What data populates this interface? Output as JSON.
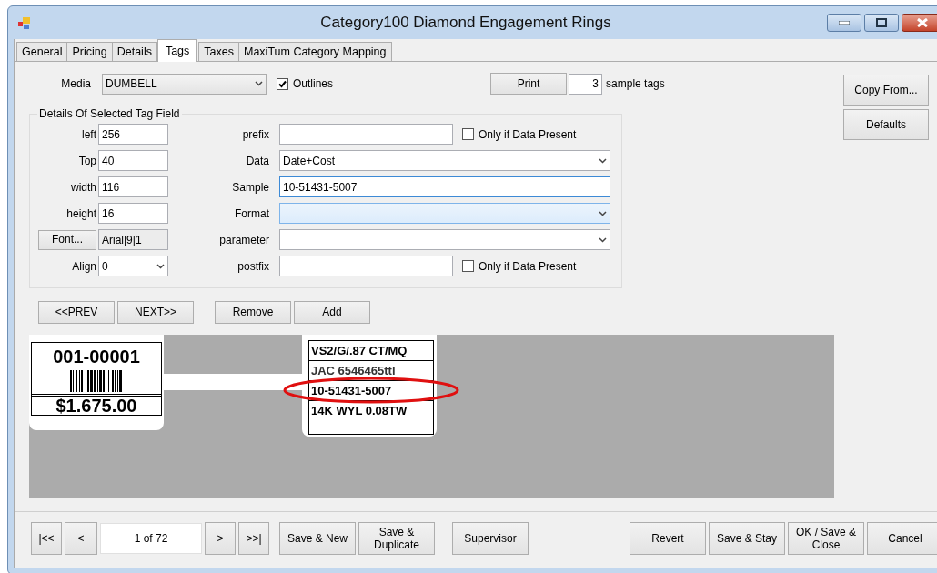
{
  "window": {
    "title": "Category100 Diamond Engagement Rings"
  },
  "tabs": [
    {
      "label": "General",
      "selected": false
    },
    {
      "label": "Pricing",
      "selected": false
    },
    {
      "label": "Details",
      "selected": false
    },
    {
      "label": "Tags",
      "selected": true
    },
    {
      "label": "Taxes",
      "selected": false
    },
    {
      "label": "MaxiTum Category Mapping",
      "selected": false
    }
  ],
  "media": {
    "label": "Media",
    "value": "DUMBELL"
  },
  "outlines": {
    "label": "Outlines",
    "checked": true
  },
  "print_button": "Print",
  "sample_count": "3",
  "sample_tags_label": "sample tags",
  "group_title": "Details Of Selected Tag Field",
  "position_fields": [
    {
      "label": "left",
      "value": "256",
      "kind": "text"
    },
    {
      "label": "Top",
      "value": "40",
      "kind": "text"
    },
    {
      "label": "width",
      "value": "116",
      "kind": "text"
    },
    {
      "label": "height",
      "value": "16",
      "kind": "text"
    },
    {
      "label": "Font...",
      "value": "Arial|9|1",
      "kind": "font"
    },
    {
      "label": "Align",
      "value": "0",
      "kind": "select"
    }
  ],
  "data_fields": [
    {
      "label": "prefix",
      "kind": "text",
      "focused": false,
      "hovered": false,
      "checkbox": {
        "label": "Only if Data Present",
        "checked": false
      }
    },
    {
      "label": "Data",
      "kind": "select",
      "value": "Date+Cost",
      "focused": false,
      "hovered": false
    },
    {
      "label": "Sample",
      "kind": "text",
      "value": "10-51431-5007",
      "focused": true,
      "hovered": false
    },
    {
      "label": "Format",
      "kind": "select",
      "focused": false,
      "hovered": true
    },
    {
      "label": "parameter",
      "kind": "select",
      "focused": false,
      "hovered": false
    },
    {
      "label": "postfix",
      "kind": "text",
      "focused": false,
      "hovered": false,
      "checkbox": {
        "label": "Only if Data Present",
        "checked": false
      }
    }
  ],
  "nav_buttons": [
    "<<PREV",
    "NEXT>>",
    "Remove",
    "Add"
  ],
  "side_buttons": [
    "Copy From...",
    "Defaults"
  ],
  "preview": {
    "left_tag": {
      "sku": "001-00001",
      "price": "$1.675.00"
    },
    "right_tag": {
      "lines": [
        "VS2/G/.87 CT/MQ",
        "JAC 6546465ttl",
        "10-51431-5007",
        "14K WYL 0.08TW"
      ]
    }
  },
  "footer": {
    "first": "|<<",
    "prev": "<",
    "record": "1 of 72",
    "next": ">",
    "last": ">>|",
    "left_buttons": [
      "Save & New",
      "Save & Duplicate",
      "Supervisor"
    ],
    "right_buttons": [
      "Revert",
      "Save & Stay",
      "OK / Save & Close",
      "Cancel"
    ]
  }
}
